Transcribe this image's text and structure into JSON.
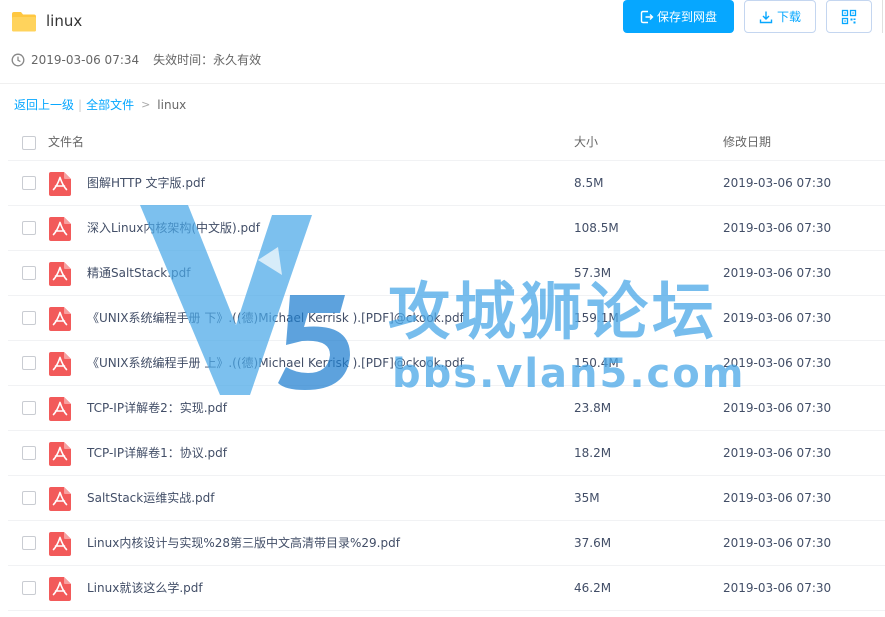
{
  "header": {
    "folder_icon": "folder-icon",
    "title": "linux",
    "shared_time": "2019-03-06 07:34",
    "expire_label": "失效时间：",
    "expire_value": "永久有效",
    "save_button": "保存到网盘",
    "download_button": "下载",
    "qr_icon": "qr-code-icon"
  },
  "breadcrumb": {
    "back": "返回上一级",
    "all_files": "全部文件",
    "arrow": ">",
    "current": "linux"
  },
  "table": {
    "headers": {
      "name": "文件名",
      "size": "大小",
      "date": "修改日期"
    },
    "rows": [
      {
        "name": "图解HTTP 文字版.pdf",
        "size": "8.5M",
        "date": "2019-03-06 07:30",
        "icon": "pdf-icon"
      },
      {
        "name": "深入Linux内核架构(中文版).pdf",
        "size": "108.5M",
        "date": "2019-03-06 07:30",
        "icon": "pdf-icon"
      },
      {
        "name": "精通SaltStack.pdf",
        "size": "57.3M",
        "date": "2019-03-06 07:30",
        "icon": "pdf-icon"
      },
      {
        "name": "《UNIX系统编程手册 下》.((德)Michael Kerrisk ).[PDF]@ckook.pdf",
        "size": "159.1M",
        "date": "2019-03-06 07:30",
        "icon": "pdf-icon"
      },
      {
        "name": "《UNIX系统编程手册 上》.((德)Michael Kerrisk ).[PDF]@ckook.pdf",
        "size": "150.4M",
        "date": "2019-03-06 07:30",
        "icon": "pdf-icon"
      },
      {
        "name": "TCP-IP详解卷2：实现.pdf",
        "size": "23.8M",
        "date": "2019-03-06 07:30",
        "icon": "pdf-icon"
      },
      {
        "name": "TCP-IP详解卷1：协议.pdf",
        "size": "18.2M",
        "date": "2019-03-06 07:30",
        "icon": "pdf-icon"
      },
      {
        "name": "SaltStack运维实战.pdf",
        "size": "35M",
        "date": "2019-03-06 07:30",
        "icon": "pdf-icon"
      },
      {
        "name": "Linux内核设计与实现%28第三版中文高清带目录%29.pdf",
        "size": "37.6M",
        "date": "2019-03-06 07:30",
        "icon": "pdf-icon"
      },
      {
        "name": "Linux就该这么学.pdf",
        "size": "46.2M",
        "date": "2019-03-06 07:30",
        "icon": "pdf-icon"
      }
    ]
  },
  "watermark": {
    "logo_mark": "V5",
    "title": "攻城狮论坛",
    "url": "bbs.vlan5.com",
    "color": "#4aa8e8"
  },
  "colors": {
    "accent": "#06a7ff",
    "pdf_red": "#f25a5a",
    "folder_yellow": "#ffc740"
  }
}
